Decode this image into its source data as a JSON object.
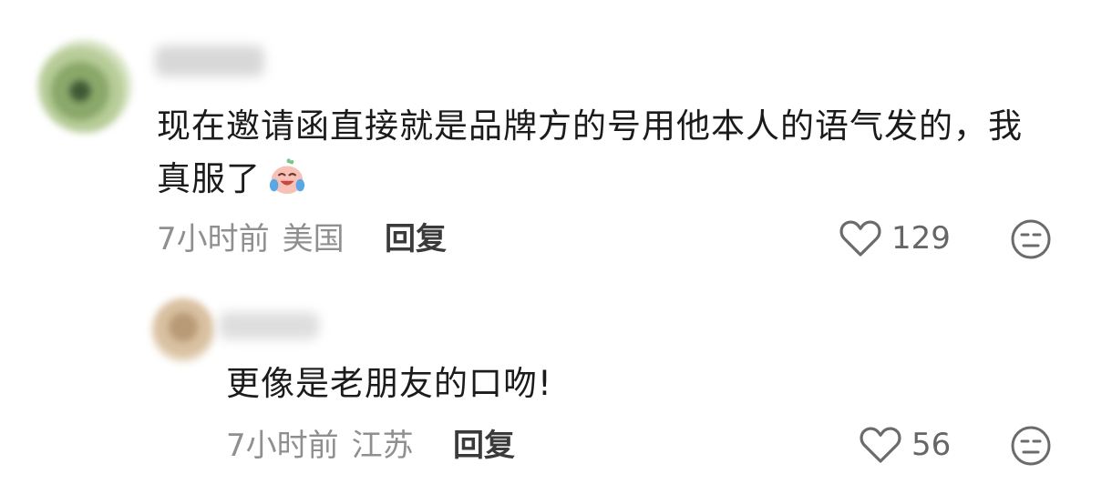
{
  "comments": [
    {
      "text": "现在邀请函直接就是品牌方的号用他本人的语气发的，我真服了",
      "emoji": "crying-laughing-peach-emoji",
      "time": "7小时前",
      "location": "美国",
      "reply_label": "回复",
      "likes": "129"
    },
    {
      "text": "更像是老朋友的口吻!",
      "time": "7小时前",
      "location": "江苏",
      "reply_label": "回复",
      "likes": "56"
    }
  ],
  "icons": {
    "like": "heart-outline-icon",
    "dislike": "meh-face-icon"
  },
  "colors": {
    "text": "#1b1b1b",
    "meta": "#8f8f8f",
    "icon": "#6b6b6b"
  }
}
